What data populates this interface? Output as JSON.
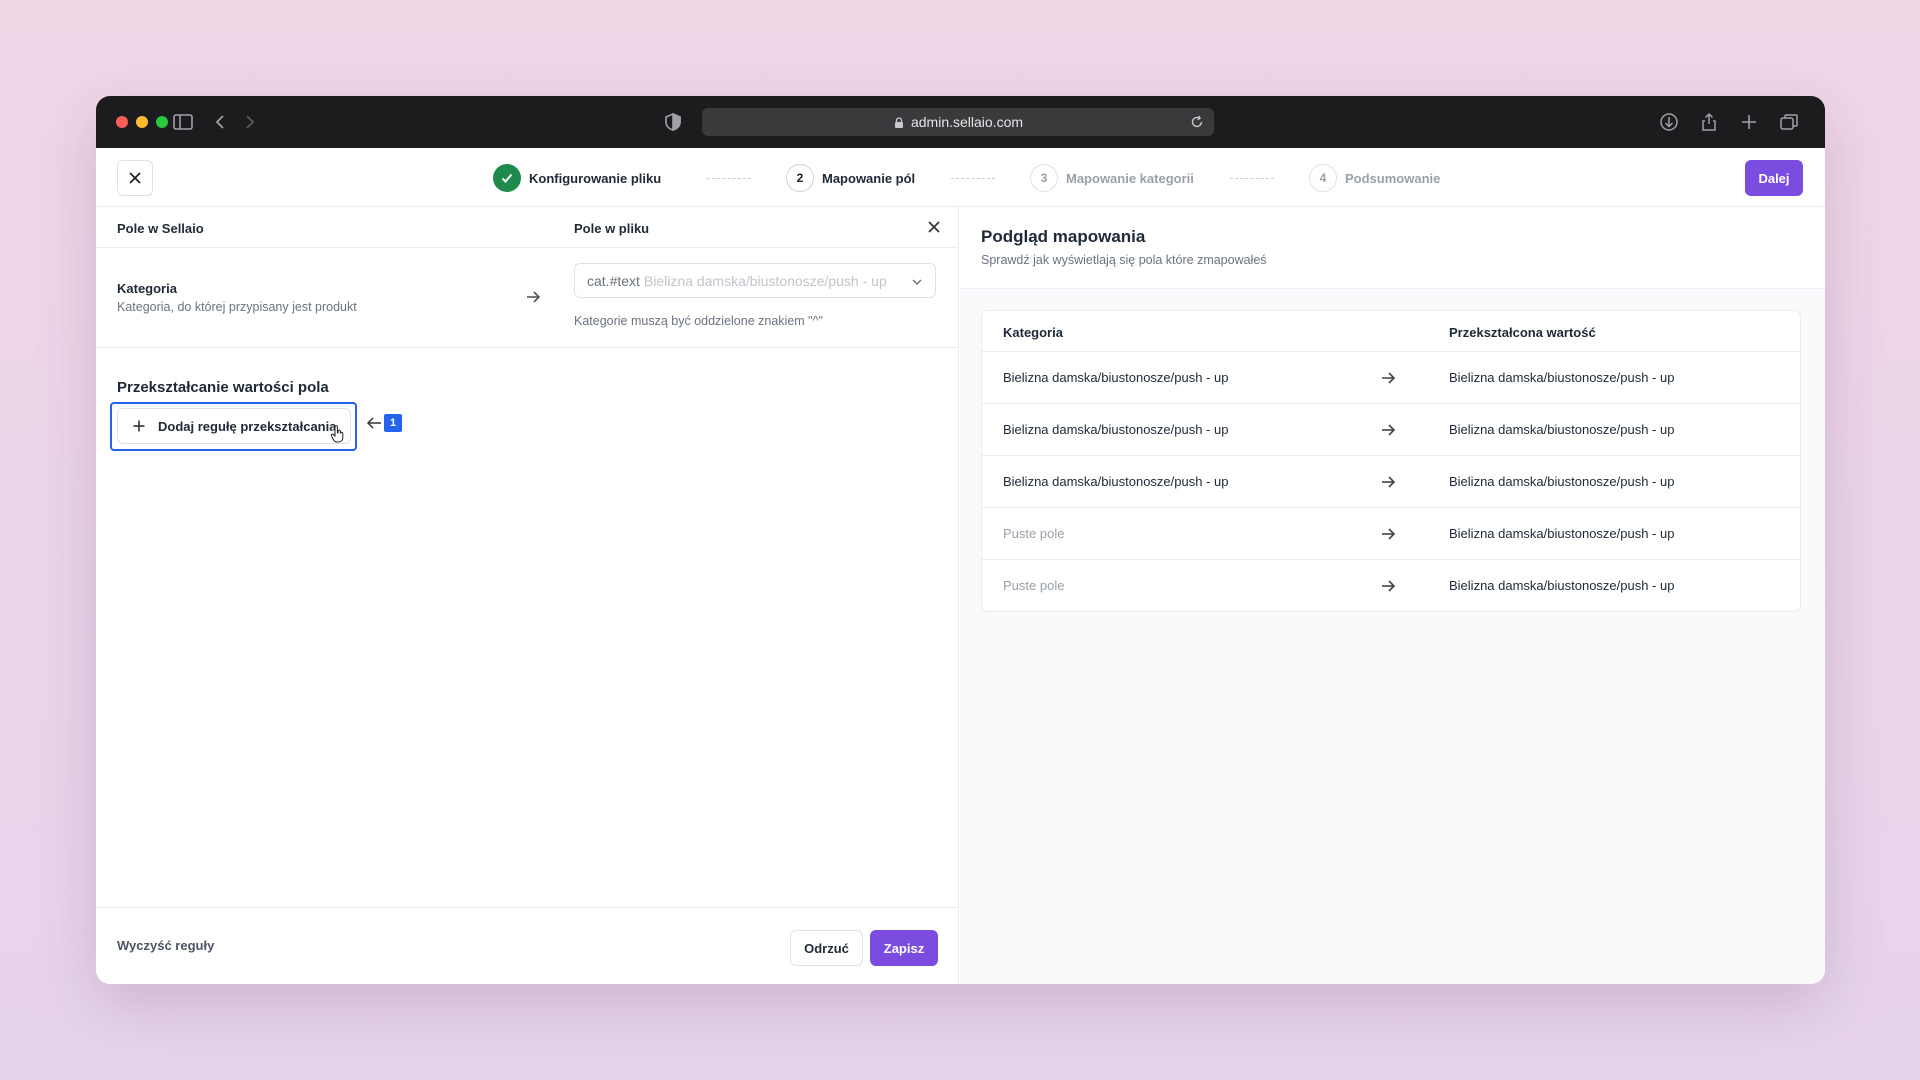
{
  "browser": {
    "url": "admin.sellaio.com"
  },
  "header": {
    "steps": [
      {
        "label": "Konfigurowanie pliku",
        "state": "done"
      },
      {
        "number": "2",
        "label": "Mapowanie pól",
        "state": "active"
      },
      {
        "number": "3",
        "label": "Mapowanie kategorii",
        "state": "pending"
      },
      {
        "number": "4",
        "label": "Podsumowanie",
        "state": "pending"
      }
    ],
    "next_label": "Dalej"
  },
  "left": {
    "col_sellaio": "Pole w Sellaio",
    "col_file": "Pole w pliku",
    "field": {
      "name": "Kategoria",
      "description": "Kategoria, do której przypisany jest produkt",
      "select_tag": "cat.#text",
      "select_value": "Bielizna damska/biustonosze/push - up",
      "hint": "Kategorie muszą być oddzielone znakiem \"^\""
    },
    "transform_title": "Przekształcanie wartości pola",
    "add_rule_label": "Dodaj regułę przekształcania",
    "callout_number": "1",
    "clear_label": "Wyczyść reguły",
    "discard_label": "Odrzuć",
    "save_label": "Zapisz"
  },
  "right": {
    "title": "Podgląd mapowania",
    "subtitle": "Sprawdź jak wyświetlają się pola które zmapowałeś",
    "col_source": "Kategoria",
    "col_result": "Przekształcona wartość",
    "rows": [
      {
        "source": "Bielizna damska/biustonosze/push - up",
        "result": "Bielizna damska/biustonosze/push - up"
      },
      {
        "source": "Bielizna damska/biustonosze/push - up",
        "result": "Bielizna damska/biustonosze/push - up"
      },
      {
        "source": "Bielizna damska/biustonosze/push - up",
        "result": "Bielizna damska/biustonosze/push - up"
      },
      {
        "source": "Puste pole",
        "result": "Bielizna damska/biustonosze/push - up"
      },
      {
        "source": "Puste pole",
        "result": "Bielizna damska/biustonosze/push - up"
      }
    ]
  },
  "colors": {
    "accent": "#7b4ce0",
    "success": "#1f8a4c",
    "highlight": "#2563eb"
  }
}
